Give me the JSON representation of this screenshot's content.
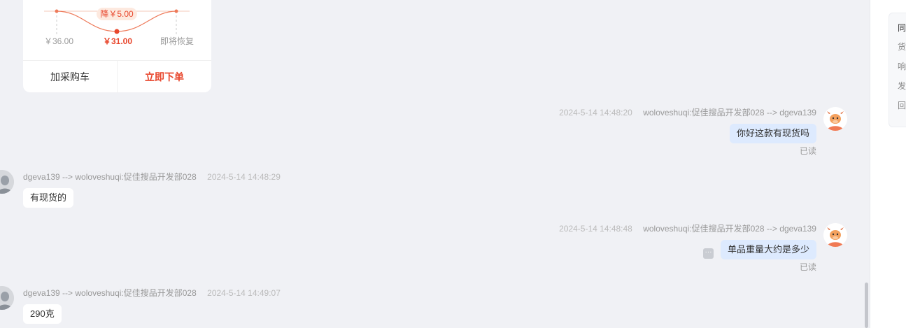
{
  "product_card": {
    "drop_label": "降￥5.00",
    "original_price": "￥36.00",
    "current_price": "￥31.00",
    "restore_label": "即将恢复",
    "add_cart": "加采购车",
    "buy_now": "立即下单"
  },
  "messages": [
    {
      "direction": "out",
      "time": "2024-5-14 14:48:20",
      "route": "woloveshuqi:促佳搜品开发部028 --> dgeva139",
      "text": "你好这款有现货吗",
      "status": "已读"
    },
    {
      "direction": "in",
      "route": "dgeva139 --> woloveshuqi:促佳搜品开发部028",
      "time": "2024-5-14 14:48:29",
      "text": "有现货的"
    },
    {
      "direction": "out",
      "time": "2024-5-14 14:48:48",
      "route": "woloveshuqi:促佳搜品开发部028 --> dgeva139",
      "text": "单品重量大约是多少",
      "status": "已读"
    },
    {
      "direction": "in",
      "route": "dgeva139 --> woloveshuqi:促佳搜品开发部028",
      "time": "2024-5-14 14:49:07",
      "text": "290克"
    }
  ],
  "right_panel": {
    "lines": [
      "同",
      "货",
      "响",
      "发",
      "回"
    ]
  },
  "colors": {
    "accent": "#e8452b",
    "bubble_out": "#ddeafe",
    "background": "#f0f1f5"
  }
}
